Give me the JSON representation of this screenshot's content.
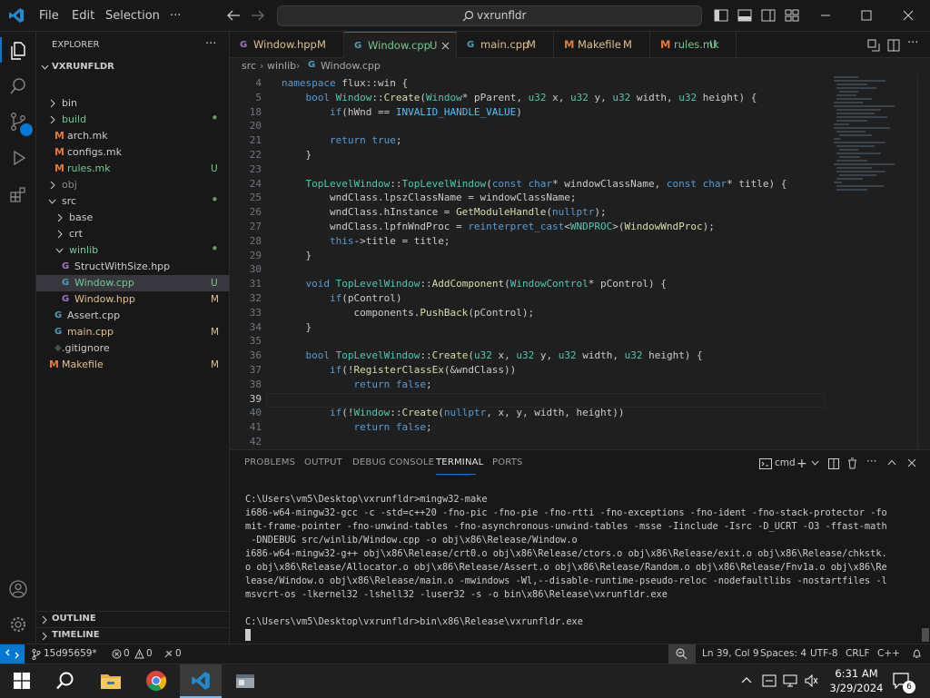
{
  "colors": {
    "accent": "#0078d4",
    "modified": "#e2c08d",
    "untracked": "#73c991",
    "background": "#1f1f1f",
    "sidebar": "#181818"
  },
  "menu": {
    "file": "File",
    "edit": "Edit",
    "selection": "Selection",
    "more": "···"
  },
  "search": {
    "text": "vxrunfldr"
  },
  "sidebar": {
    "title": "EXPLORER",
    "more": "···",
    "root": "VXRUNFLDR",
    "items": [
      {
        "label": "bin",
        "badge": ""
      },
      {
        "label": "build",
        "badge": "•"
      },
      {
        "label": "arch.mk",
        "badge": ""
      },
      {
        "label": "configs.mk",
        "badge": ""
      },
      {
        "label": "rules.mk",
        "badge": "U"
      },
      {
        "label": "obj",
        "badge": ""
      },
      {
        "label": "src",
        "badge": "•"
      },
      {
        "label": "base",
        "badge": ""
      },
      {
        "label": "crt",
        "badge": ""
      },
      {
        "label": "winlib",
        "badge": "•"
      },
      {
        "label": "StructWithSize.hpp",
        "badge": ""
      },
      {
        "label": "Window.cpp",
        "badge": "U"
      },
      {
        "label": "Window.hpp",
        "badge": "M"
      },
      {
        "label": "Assert.cpp",
        "badge": ""
      },
      {
        "label": "main.cpp",
        "badge": "M"
      },
      {
        "label": ".gitignore",
        "badge": ""
      },
      {
        "label": "Makefile",
        "badge": "M"
      }
    ],
    "outline": "OUTLINE",
    "timeline": "TIMELINE"
  },
  "tabs": [
    {
      "label": "Window.hpp",
      "badge": "M"
    },
    {
      "label": "Window.cpp",
      "badge": "U"
    },
    {
      "label": "main.cpp",
      "badge": "M"
    },
    {
      "label": "Makefile",
      "badge": "M"
    },
    {
      "label": "rules.mk",
      "badge": "U"
    }
  ],
  "breadcrumbs": [
    "src",
    "winlib",
    "Window.cpp"
  ],
  "editor": {
    "lines": [
      {
        "n": "4",
        "t": "namespace flux::win {"
      },
      {
        "n": "5",
        "t": "    bool Window::Create(Window* pParent, u32 x, u32 y, u32 width, u32 height) {"
      },
      {
        "n": "18",
        "t": "        if(hWnd == INVALID_HANDLE_VALUE)"
      },
      {
        "n": "20",
        "t": ""
      },
      {
        "n": "21",
        "t": "        return true;"
      },
      {
        "n": "22",
        "t": "    }"
      },
      {
        "n": "23",
        "t": ""
      },
      {
        "n": "24",
        "t": "    TopLevelWindow::TopLevelWindow(const char* windowClassName, const char* title) {"
      },
      {
        "n": "25",
        "t": "        wndClass.lpszClassName = windowClassName;"
      },
      {
        "n": "26",
        "t": "        wndClass.hInstance = GetModuleHandle(nullptr);"
      },
      {
        "n": "27",
        "t": "        wndClass.lpfnWndProc = reinterpret_cast<WNDPROC>(WindowWndProc);"
      },
      {
        "n": "28",
        "t": "        this->title = title;"
      },
      {
        "n": "29",
        "t": "    }"
      },
      {
        "n": "30",
        "t": ""
      },
      {
        "n": "31",
        "t": "    void TopLevelWindow::AddComponent(WindowControl* pControl) {"
      },
      {
        "n": "32",
        "t": "        if(pControl)"
      },
      {
        "n": "33",
        "t": "            components.PushBack(pControl);"
      },
      {
        "n": "34",
        "t": "    }"
      },
      {
        "n": "35",
        "t": ""
      },
      {
        "n": "36",
        "t": "    bool TopLevelWindow::Create(u32 x, u32 y, u32 width, u32 height) {"
      },
      {
        "n": "37",
        "t": "        if(!RegisterClassEx(&wndClass))"
      },
      {
        "n": "38",
        "t": "            return false;"
      },
      {
        "n": "39",
        "t": ""
      },
      {
        "n": "40",
        "t": "        if(!Window::Create(nullptr, x, y, width, height))"
      },
      {
        "n": "41",
        "t": "            return false;"
      },
      {
        "n": "42",
        "t": ""
      }
    ]
  },
  "panel": {
    "tabs": [
      "PROBLEMS",
      "OUTPUT",
      "DEBUG CONSOLE",
      "TERMINAL",
      "PORTS"
    ],
    "shell": "cmd",
    "terminal": [
      "C:\\Users\\vm5\\Desktop\\vxrunfldr>mingw32-make",
      "i686-w64-mingw32-gcc -c -std=c++20 -fno-pic -fno-pie -fno-rtti -fno-exceptions -fno-ident -fno-stack-protector -fo",
      "mit-frame-pointer -fno-unwind-tables -fno-asynchronous-unwind-tables -msse -Iinclude -Isrc -D_UCRT -O3 -ffast-math",
      " -DNDEBUG src/winlib/Window.cpp -o obj\\x86\\Release/Window.o",
      "i686-w64-mingw32-g++ obj\\x86\\Release/crt0.o obj\\x86\\Release/ctors.o obj\\x86\\Release/exit.o obj\\x86\\Release/chkstk.",
      "o obj\\x86\\Release/Allocator.o obj\\x86\\Release/Assert.o obj\\x86\\Release/Random.o obj\\x86\\Release/Fnv1a.o obj\\x86\\Re",
      "lease/Window.o obj\\x86\\Release/main.o -mwindows -Wl,--disable-runtime-pseudo-reloc -nodefaultlibs -nostartfiles -l",
      "msvcrt-os -lkernel32 -lshell32 -luser32 -s -o bin\\x86\\Release\\vxrunfldr.exe",
      "",
      "C:\\Users\\vm5\\Desktop\\vxrunfldr>bin\\x86\\Release\\vxrunfldr.exe"
    ]
  },
  "status": {
    "branch": "15d95659*",
    "errors": "0",
    "warnings": "0",
    "ports": "0",
    "position": "Ln 39, Col 9",
    "spaces": "Spaces: 4",
    "encoding": "UTF-8",
    "eol": "CRLF",
    "language": "C++"
  },
  "taskbar": {
    "time": "6:31 AM",
    "date": "3/29/2024",
    "notifications": "6"
  }
}
